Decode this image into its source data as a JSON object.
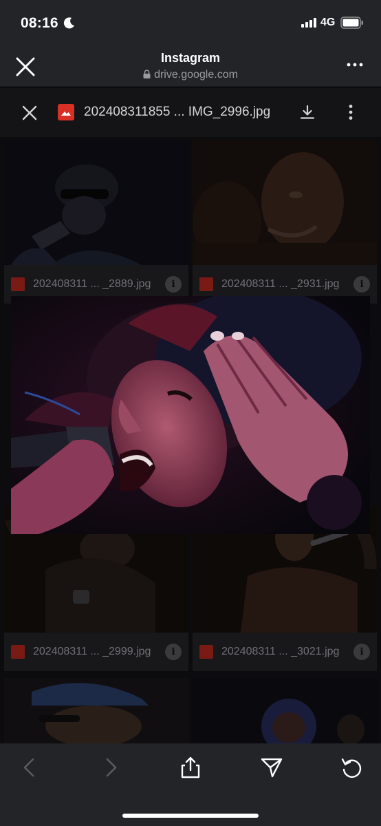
{
  "status_bar": {
    "time": "08:16",
    "network": "4G"
  },
  "browser": {
    "title": "Instagram",
    "url": "drive.google.com"
  },
  "viewer": {
    "filename": "202408311855 ... IMG_2996.jpg"
  },
  "tiles": [
    {
      "name": "202408311 ... _2889.jpg"
    },
    {
      "name": "202408311 ... _2931.jpg"
    },
    {
      "name": "202408311 ... _2999.jpg"
    },
    {
      "name": "202408311 ... _3021.jpg"
    }
  ],
  "info_glyph": "i",
  "colors": {
    "chrome_bg": "#232428",
    "page_bg": "#0c0c0e",
    "file_icon_red": "#d93025",
    "photo_magenta": "#8a2a5a"
  },
  "icons": [
    "moon-icon",
    "signal-icon",
    "battery-icon",
    "close-icon",
    "lock-icon",
    "more-icon",
    "download-icon",
    "kebab-icon",
    "info-icon",
    "back-icon",
    "forward-icon",
    "share-icon",
    "send-icon",
    "reload-icon"
  ]
}
